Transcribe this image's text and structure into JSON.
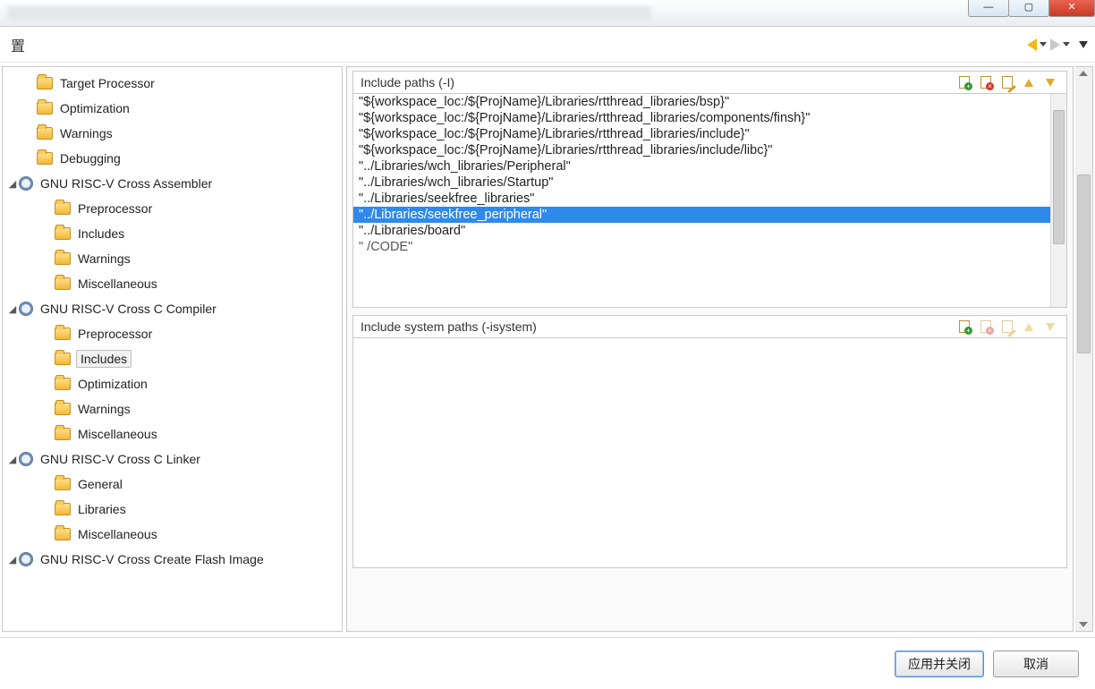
{
  "window": {
    "tab_char": "置",
    "buttons": {
      "apply_close": "应用并关闭",
      "cancel": "取消"
    }
  },
  "tree": [
    {
      "d": 1,
      "icon": "folder",
      "tw": "",
      "label": "Target Processor"
    },
    {
      "d": 1,
      "icon": "folder",
      "tw": "",
      "label": "Optimization"
    },
    {
      "d": 1,
      "icon": "folder",
      "tw": "",
      "label": "Warnings"
    },
    {
      "d": 1,
      "icon": "folder",
      "tw": "",
      "label": "Debugging"
    },
    {
      "d": 0,
      "icon": "gear",
      "tw": "◢",
      "label": "GNU RISC-V Cross Assembler"
    },
    {
      "d": 2,
      "icon": "folder",
      "tw": "",
      "label": "Preprocessor"
    },
    {
      "d": 2,
      "icon": "folder",
      "tw": "",
      "label": "Includes"
    },
    {
      "d": 2,
      "icon": "folder",
      "tw": "",
      "label": "Warnings"
    },
    {
      "d": 2,
      "icon": "folder",
      "tw": "",
      "label": "Miscellaneous"
    },
    {
      "d": 0,
      "icon": "gear",
      "tw": "◢",
      "label": "GNU RISC-V Cross C Compiler"
    },
    {
      "d": 2,
      "icon": "folder",
      "tw": "",
      "label": "Preprocessor"
    },
    {
      "d": 2,
      "icon": "folder",
      "tw": "",
      "label": "Includes",
      "selected": true
    },
    {
      "d": 2,
      "icon": "folder",
      "tw": "",
      "label": "Optimization"
    },
    {
      "d": 2,
      "icon": "folder",
      "tw": "",
      "label": "Warnings"
    },
    {
      "d": 2,
      "icon": "folder",
      "tw": "",
      "label": "Miscellaneous"
    },
    {
      "d": 0,
      "icon": "gear",
      "tw": "◢",
      "label": "GNU RISC-V Cross C Linker"
    },
    {
      "d": 2,
      "icon": "folder",
      "tw": "",
      "label": "General"
    },
    {
      "d": 2,
      "icon": "folder",
      "tw": "",
      "label": "Libraries"
    },
    {
      "d": 2,
      "icon": "folder",
      "tw": "",
      "label": "Miscellaneous"
    },
    {
      "d": 0,
      "icon": "gear",
      "tw": "◢",
      "label": "GNU RISC-V Cross Create Flash Image"
    }
  ],
  "section1": {
    "title": "Include paths (-I)",
    "items": [
      "\"${workspace_loc:/${ProjName}/Libraries/rtthread_libraries/bsp}\"",
      "\"${workspace_loc:/${ProjName}/Libraries/rtthread_libraries/components/finsh}\"",
      "\"${workspace_loc:/${ProjName}/Libraries/rtthread_libraries/include}\"",
      "\"${workspace_loc:/${ProjName}/Libraries/rtthread_libraries/include/libc}\"",
      "\"../Libraries/wch_libraries/Peripheral\"",
      "\"../Libraries/wch_libraries/Startup\"",
      "\"../Libraries/seekfree_libraries\"",
      "\"../Libraries/seekfree_peripheral\"",
      "\"../Libraries/board\"",
      "\"  /CODE\""
    ],
    "selected_index": 7
  },
  "section2": {
    "title": "Include system paths (-isystem)"
  }
}
